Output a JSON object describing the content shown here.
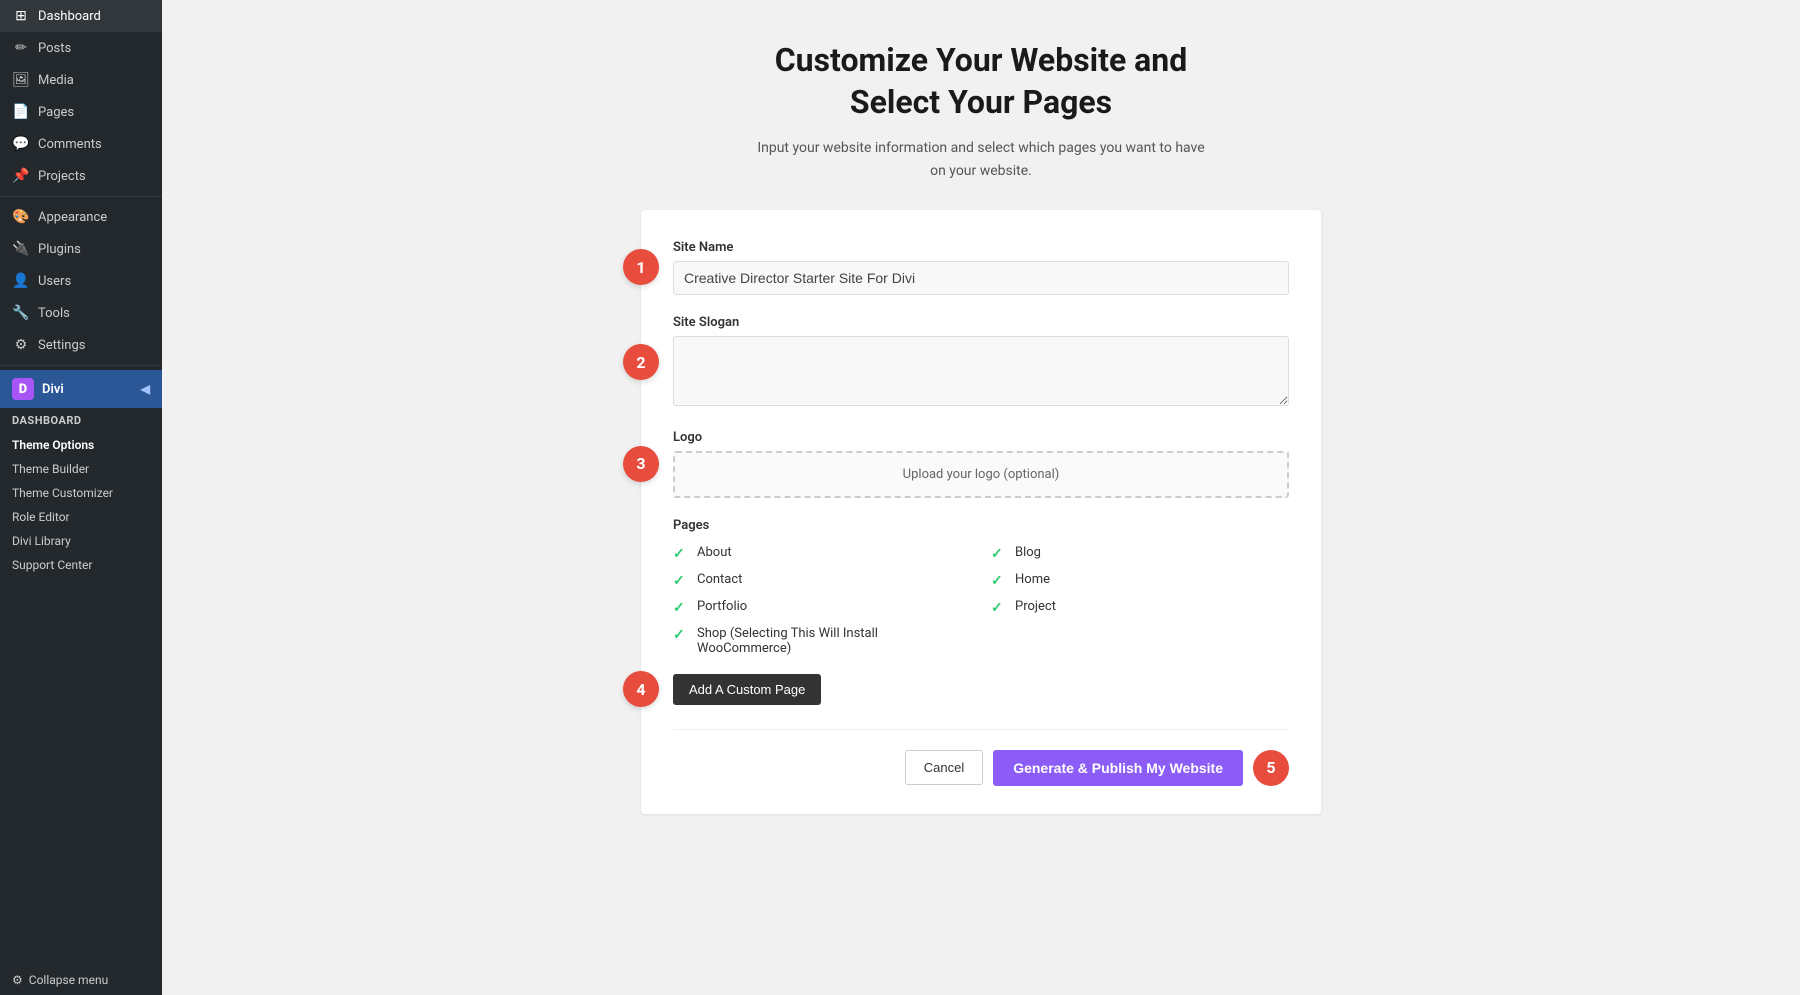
{
  "sidebar": {
    "items": [
      {
        "id": "dashboard",
        "label": "Dashboard",
        "icon": "⊞"
      },
      {
        "id": "posts",
        "label": "Posts",
        "icon": "✏"
      },
      {
        "id": "media",
        "label": "Media",
        "icon": "🖼"
      },
      {
        "id": "pages",
        "label": "Pages",
        "icon": "📄"
      },
      {
        "id": "comments",
        "label": "Comments",
        "icon": "💬"
      },
      {
        "id": "projects",
        "label": "Projects",
        "icon": "📌"
      },
      {
        "id": "appearance",
        "label": "Appearance",
        "icon": "🎨"
      },
      {
        "id": "plugins",
        "label": "Plugins",
        "icon": "🔌"
      },
      {
        "id": "users",
        "label": "Users",
        "icon": "👤"
      },
      {
        "id": "tools",
        "label": "Tools",
        "icon": "🔧"
      },
      {
        "id": "settings",
        "label": "Settings",
        "icon": "⚙"
      }
    ],
    "divi_label": "Divi",
    "divi_sub_header": "Dashboard",
    "divi_sub_items": [
      {
        "id": "theme-options",
        "label": "Theme Options"
      },
      {
        "id": "theme-builder",
        "label": "Theme Builder"
      },
      {
        "id": "theme-customizer",
        "label": "Theme Customizer"
      },
      {
        "id": "role-editor",
        "label": "Role Editor"
      },
      {
        "id": "divi-library",
        "label": "Divi Library"
      },
      {
        "id": "support-center",
        "label": "Support Center"
      }
    ],
    "collapse_label": "Collapse menu"
  },
  "main": {
    "title": "Customize Your Website and\nSelect Your Pages",
    "subtitle": "Input your website information and select which pages you want to have\non your website.",
    "form": {
      "site_name_label": "Site Name",
      "site_name_value": "Creative Director Starter Site For Divi",
      "site_slogan_label": "Site Slogan",
      "site_slogan_placeholder": "",
      "logo_label": "Logo",
      "logo_upload_text": "Upload your logo (optional)",
      "pages_label": "Pages",
      "pages": [
        {
          "id": "about",
          "label": "About",
          "checked": true
        },
        {
          "id": "blog",
          "label": "Blog",
          "checked": true
        },
        {
          "id": "contact",
          "label": "Contact",
          "checked": true
        },
        {
          "id": "home",
          "label": "Home",
          "checked": true
        },
        {
          "id": "portfolio",
          "label": "Portfolio",
          "checked": true
        },
        {
          "id": "project",
          "label": "Project",
          "checked": true
        },
        {
          "id": "shop",
          "label": "Shop (Selecting This Will Install WooCommerce)",
          "checked": true
        }
      ],
      "add_custom_page_label": "Add A Custom Page",
      "cancel_label": "Cancel",
      "publish_label": "Generate & Publish My Website"
    },
    "steps": [
      "1",
      "2",
      "3",
      "4",
      "5"
    ]
  }
}
